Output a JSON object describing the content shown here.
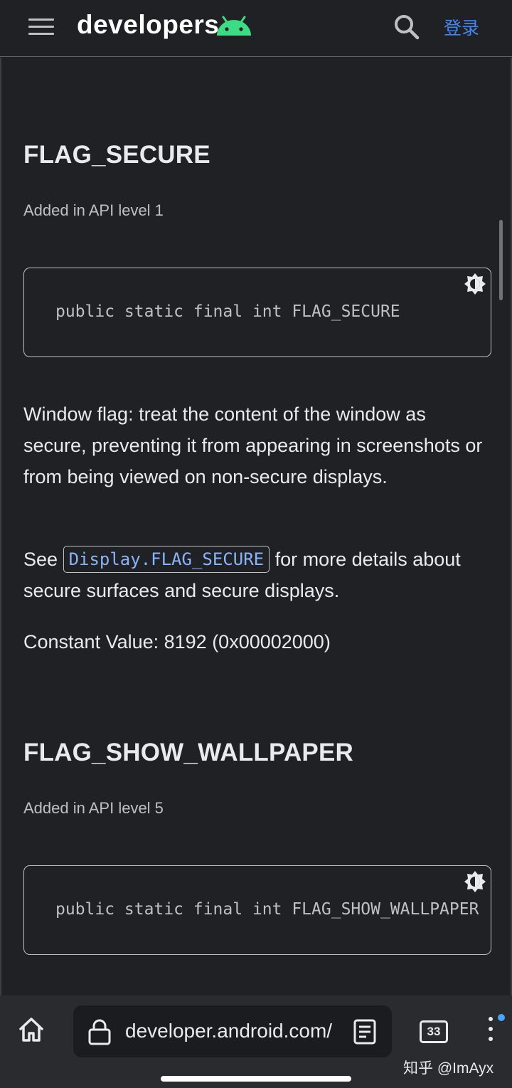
{
  "header": {
    "logo_text": "developers",
    "login_label": "登录",
    "brand_color": "#3ddc84",
    "link_color": "#4285f4"
  },
  "sections": [
    {
      "title": "FLAG_SECURE",
      "api_level": "Added in API level 1",
      "code": "public static final int FLAG_SECURE",
      "description": "Window flag: treat the content of the window as secure, preventing it from appearing in screenshots or from being viewed on non-secure displays.",
      "see_prefix": "See",
      "see_link": "Display.FLAG_SECURE",
      "see_suffix": "for more details about secure surfaces and secure displays.",
      "constant_value": "Constant Value: 8192 (0x00002000)"
    },
    {
      "title": "FLAG_SHOW_WALLPAPER",
      "api_level": "Added in API level 5",
      "code": "public static final int FLAG_SHOW_WALLPAPER"
    }
  ],
  "browser": {
    "url": "developer.android.com/",
    "tab_count": "33",
    "watermark": "知乎 @ImAyx",
    "notification_color": "#4aa3ff"
  },
  "icons": {
    "menu": "hamburger-menu-icon",
    "search": "search-icon",
    "theme": "theme-toggle-icon",
    "home": "home-icon",
    "lock": "lock-icon",
    "reader": "reader-mode-icon",
    "tabs": "tabs-icon",
    "more": "more-vert-icon"
  }
}
